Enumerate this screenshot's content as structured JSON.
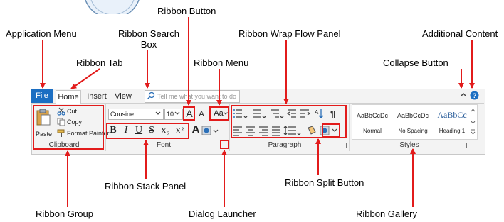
{
  "callouts": {
    "ribbon_button": "Ribbon Button",
    "application_menu": "Application Menu",
    "ribbon_search_box_line1": "Ribbon Search",
    "ribbon_search_box_line2": "Box",
    "ribbon_wrap_flow_panel": "Ribbon Wrap Flow Panel",
    "additional_content": "Additional Content",
    "ribbon_tab": "Ribbon Tab",
    "ribbon_menu": "Ribbon Menu",
    "collapse_button": "Collapse Button",
    "ribbon_stack_panel": "Ribbon Stack Panel",
    "ribbon_split_button": "Ribbon Split Button",
    "ribbon_group": "Ribbon Group",
    "dialog_launcher": "Dialog Launcher",
    "ribbon_gallery": "Ribbon Gallery"
  },
  "tabs": {
    "file": "File",
    "home": "Home",
    "insert": "Insert",
    "view": "View"
  },
  "search": {
    "placeholder": "Tell me what you want to do"
  },
  "clipboard": {
    "paste": "Paste",
    "cut": "Cut",
    "copy": "Copy",
    "format_painter": "Format Painter",
    "title": "Clipboard"
  },
  "font": {
    "family": "Cousine",
    "size": "10",
    "grow": "A",
    "shrink": "A",
    "change_case": "Aa",
    "bold": "B",
    "italic": "I",
    "underline": "U",
    "strike": "S",
    "subscript": "X₂",
    "superscript": "X²",
    "font_color": "A",
    "title": "Font"
  },
  "paragraph": {
    "sort": "A↓",
    "show_marks": "¶",
    "title": "Paragraph"
  },
  "styles": {
    "items": [
      {
        "preview": "AaBbCcDc",
        "name": "Normal"
      },
      {
        "preview": "AaBbCcDc",
        "name": "No Spacing"
      },
      {
        "preview": "AaBbCc",
        "name": "Heading 1"
      }
    ],
    "title": "Styles"
  },
  "colors": {
    "file_tab": "#1b6ec2",
    "highlight_box": "#e21b1b",
    "help_icon": "#1b6ec2"
  }
}
